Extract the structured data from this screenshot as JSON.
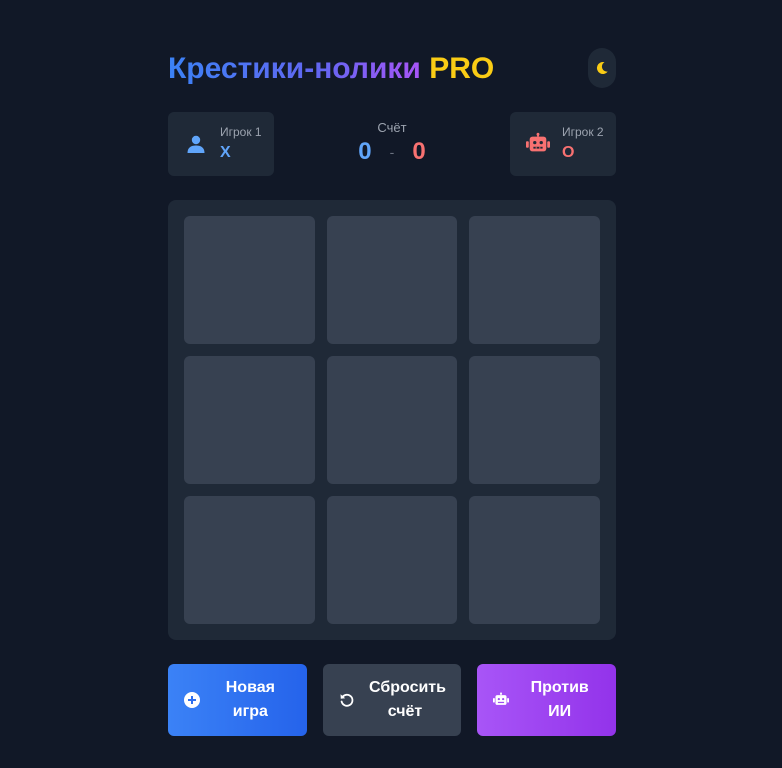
{
  "header": {
    "title_main": "Крестики-нолики",
    "title_accent": "PRO",
    "theme_icon": "moon-icon"
  },
  "players": {
    "p1": {
      "name": "Игрок 1",
      "mark": "X",
      "icon": "user-icon",
      "color": "#60a5fa"
    },
    "p2": {
      "name": "Игрок 2",
      "mark": "O",
      "icon": "robot-icon",
      "color": "#f87171"
    }
  },
  "score": {
    "label": "Счёт",
    "x": "0",
    "separator": "-",
    "o": "0"
  },
  "board": {
    "cells": [
      "",
      "",
      "",
      "",
      "",
      "",
      "",
      "",
      ""
    ]
  },
  "controls": {
    "new_game": {
      "label": "Новая игра",
      "icon": "plus-circle-icon"
    },
    "reset_score": {
      "label": "Сбросить счёт",
      "icon": "undo-icon"
    },
    "vs_ai": {
      "label": "Против ИИ",
      "icon": "robot-icon"
    }
  },
  "colors": {
    "background": "#111827",
    "card": "#1f2937",
    "cell": "#374151",
    "accent_blue": "#3b82f6",
    "accent_purple": "#a855f7",
    "accent_yellow": "#facc15"
  }
}
